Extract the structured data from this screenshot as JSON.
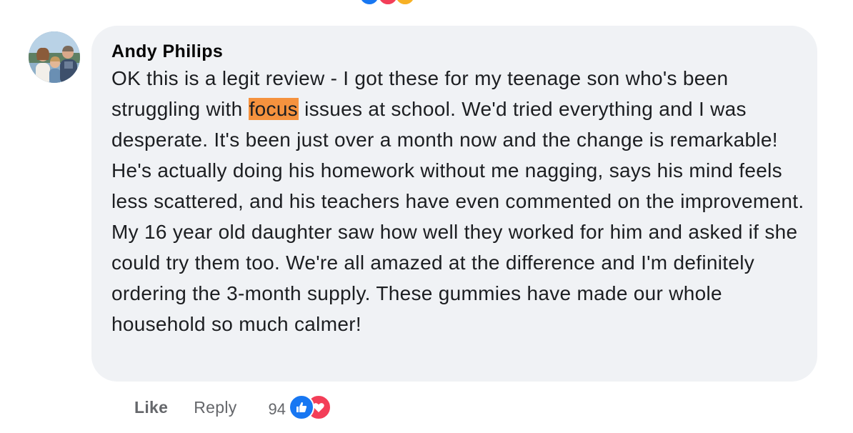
{
  "comment": {
    "author": "Andy Philips",
    "text_before_highlight": "OK this is a legit review - I got these for my teenage son who's been struggling with ",
    "highlight": "focus",
    "text_after_highlight": " issues at school. We'd tried everything and I was desperate. It's been just over a month now and the change is remarkable! He's actually doing his homework without me nagging, says his mind feels less scattered, and his teachers have even commented on the improvement. My 16 year old daughter saw how well they worked for him and asked if she could try them too. We're all amazed at the difference and I'm definitely ordering the 3-month supply. These gummies have made our whole household so much calmer!"
  },
  "actions": {
    "like_label": "Like",
    "reply_label": "Reply",
    "reaction_count": "94",
    "reaction_icons": [
      "like-icon",
      "love-icon"
    ]
  },
  "previous_comment": {
    "reaction_icons": [
      "like-icon",
      "love-icon",
      "haha-icon"
    ]
  },
  "colors": {
    "bubble_bg": "#f0f2f5",
    "highlight": "#f5923e",
    "like_blue": "#1877f2",
    "love_red": "#f33e58",
    "muted_text": "#65676b"
  }
}
